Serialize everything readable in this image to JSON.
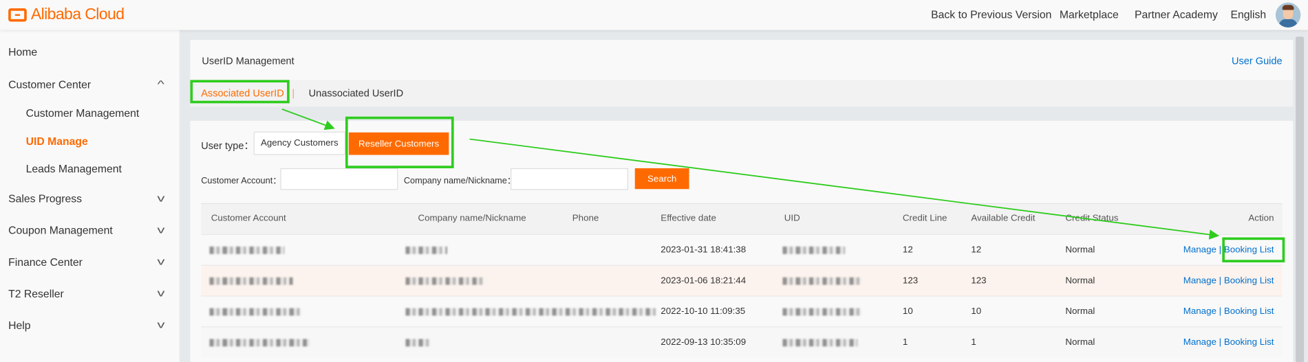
{
  "header": {
    "logo": "Alibaba Cloud",
    "links": [
      "Back to Previous Version",
      "Marketplace",
      "Partner Academy",
      "English"
    ]
  },
  "sidebar": {
    "items": [
      {
        "label": "Home"
      },
      {
        "label": "Customer Center",
        "chevron": "^"
      },
      {
        "label": "Customer Management"
      },
      {
        "label": "UID Manage"
      },
      {
        "label": "Leads Management"
      },
      {
        "label": "Sales Progress",
        "chevron": "v"
      },
      {
        "label": "Coupon Management",
        "chevron": "v"
      },
      {
        "label": "Finance Center",
        "chevron": "v"
      },
      {
        "label": "T2 Reseller",
        "chevron": "v"
      },
      {
        "label": "Help",
        "chevron": "v"
      }
    ]
  },
  "page": {
    "title": "UserID Management",
    "user_guide": "User Guide",
    "tabs": [
      "Associated UserID",
      "Unassociated UserID"
    ],
    "tab_sep": "|"
  },
  "filters": {
    "user_type_label": "User type：",
    "agency": "Agency Customers",
    "reseller": "Reseller Customers",
    "customer_account_label": "Customer Account：",
    "company_label": "Company name/Nickname：",
    "search": "Search",
    "customer_account_value": "",
    "company_value": ""
  },
  "table": {
    "headers": [
      "Customer Account",
      "Company name/Nickname",
      "Phone",
      "Effective date",
      "UID",
      "Credit Line",
      "Available Credit",
      "Credit Status",
      "Action"
    ],
    "rows": [
      {
        "date": "2023-01-31 18:41:38",
        "credit_line": "12",
        "available": "12",
        "status": "Normal"
      },
      {
        "date": "2023-01-06 18:21:44",
        "credit_line": "123",
        "available": "123",
        "status": "Normal"
      },
      {
        "date": "2022-10-10 11:09:35",
        "credit_line": "10",
        "available": "10",
        "status": "Normal"
      },
      {
        "date": "2022-09-13 10:35:09",
        "credit_line": "1",
        "available": "1",
        "status": "Normal"
      }
    ],
    "manage": "Manage",
    "sep": "|",
    "booking": "Booking List"
  },
  "colors": {
    "accent": "#ff6a00",
    "link": "#0070cc",
    "annotation": "#2ecc1e"
  }
}
